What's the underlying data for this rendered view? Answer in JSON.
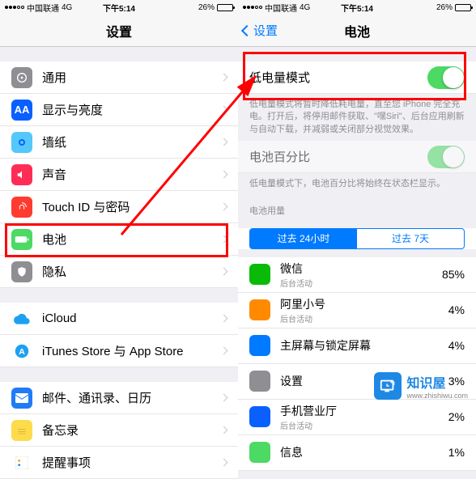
{
  "status": {
    "carrier": "中国联通",
    "network": "4G",
    "time": "下午5:14",
    "battery_pct": "26%"
  },
  "left": {
    "title": "设置",
    "rows": [
      {
        "icon": "general-icon",
        "bg": "#8e8e93",
        "label": "通用"
      },
      {
        "icon": "display-icon",
        "bg": "#0a60ff",
        "label": "显示与亮度"
      },
      {
        "icon": "wallpaper-icon",
        "bg": "#54c8fa",
        "label": "墙纸"
      },
      {
        "icon": "sound-icon",
        "bg": "#ff2d55",
        "label": "声音"
      },
      {
        "icon": "touchid-icon",
        "bg": "#ff3b30",
        "label": "Touch ID 与密码"
      },
      {
        "icon": "battery-icon",
        "bg": "#4cd964",
        "label": "电池"
      },
      {
        "icon": "privacy-icon",
        "bg": "#8e8e93",
        "label": "隐私"
      }
    ],
    "rows2": [
      {
        "icon": "icloud-icon",
        "bg": "#fff",
        "label": "iCloud"
      },
      {
        "icon": "appstore-icon",
        "bg": "#fff",
        "label": "iTunes Store 与 App Store"
      }
    ],
    "rows3": [
      {
        "icon": "mail-icon",
        "bg": "#1f7cf6",
        "label": "邮件、通讯录、日历"
      },
      {
        "icon": "notes-icon",
        "bg": "#fedb4b",
        "label": "备忘录"
      },
      {
        "icon": "reminders-icon",
        "bg": "#fff",
        "label": "提醒事项"
      }
    ]
  },
  "right": {
    "back": "设置",
    "title": "电池",
    "low_power_label": "低电量模式",
    "low_power_desc": "低电量模式将暂时降低耗电量，直至您 iPhone 完全充电。打开后，将停用邮件获取、\"嘿Siri\"、后台应用刷新与自动下载，并减弱或关闭部分视觉效果。",
    "pct_label": "电池百分比",
    "pct_desc": "低电量模式下，电池百分比将始终在状态栏显示。",
    "usage_header": "电池用量",
    "seg1": "过去 24小时",
    "seg2": "过去 7天",
    "apps": [
      {
        "name": "微信",
        "sub": "后台活动",
        "pct": "85%",
        "bg": "#09bb07"
      },
      {
        "name": "阿里小号",
        "sub": "后台活动",
        "pct": "4%",
        "bg": "#ff8a00"
      },
      {
        "name": "主屏幕与锁定屏幕",
        "sub": "",
        "pct": "4%",
        "bg": "#007aff"
      },
      {
        "name": "设置",
        "sub": "",
        "pct": "3%",
        "bg": "#8e8e93"
      },
      {
        "name": "手机营业厅",
        "sub": "后台活动",
        "pct": "2%",
        "bg": "#0a60ff"
      },
      {
        "name": "信息",
        "sub": "",
        "pct": "1%",
        "bg": "#4cd964"
      }
    ]
  },
  "watermark": {
    "name": "知识屋",
    "url": "www.zhishiwu.com"
  }
}
